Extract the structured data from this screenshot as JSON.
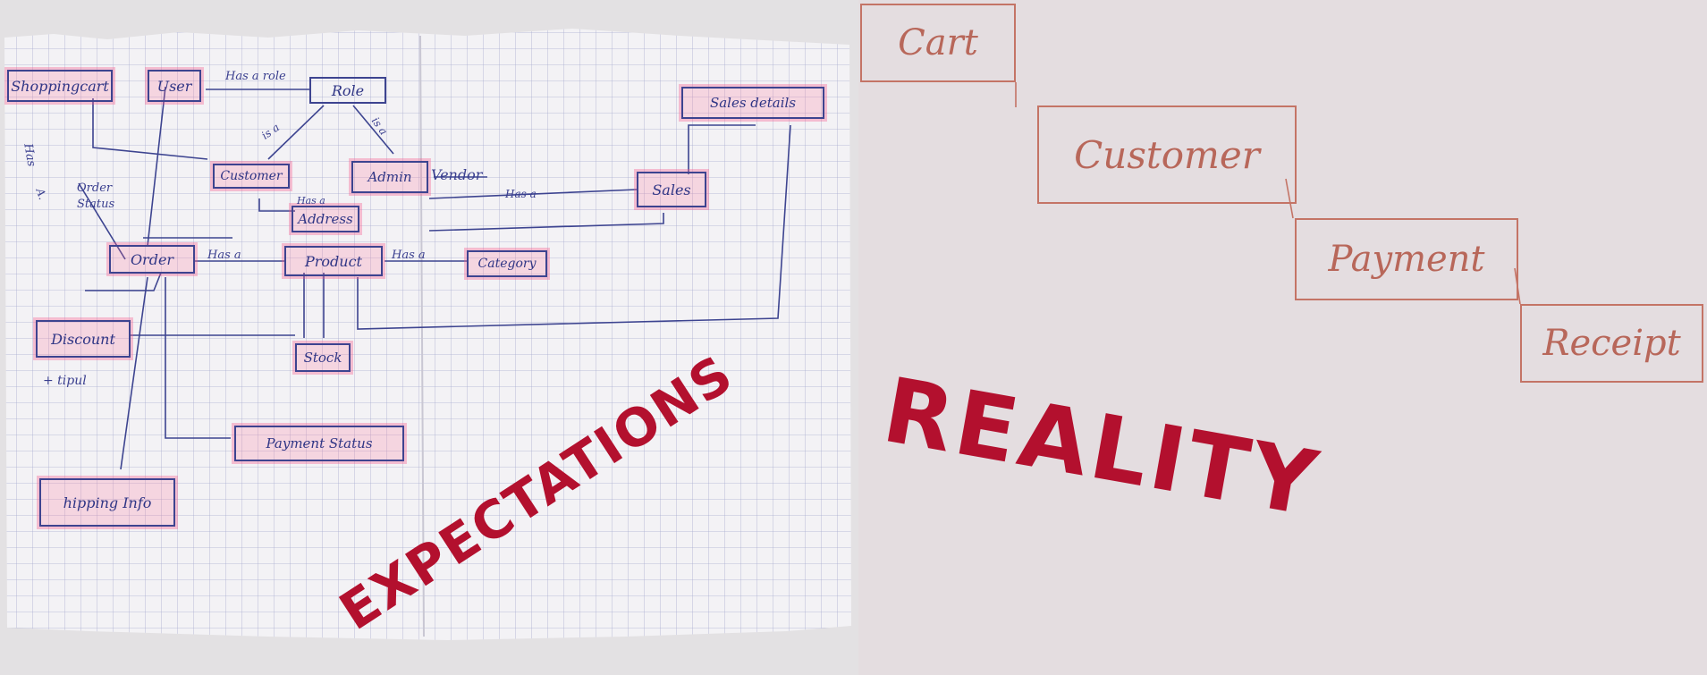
{
  "colors": {
    "ink": "#3d4490",
    "highlighter": "#f06a96",
    "red_pen": "#c47466",
    "banner": "#b3102e"
  },
  "expectations": {
    "banner": "EXPECTATIONS",
    "nodes": {
      "shopping_cart": "Shoppingcart",
      "user": "User",
      "role": "Role",
      "sales_details": "Sales details",
      "customer": "Customer",
      "admin": "Admin",
      "vendor": "Vendor",
      "sales": "Sales",
      "order_status": "Order Status",
      "address": "Address",
      "order": "Order",
      "product": "Product",
      "category": "Category",
      "discount": "Discount",
      "stock": "Stock",
      "payment_status": "Payment Status",
      "shipping_info": "hipping Info"
    },
    "edge_labels": {
      "has_a_role": "Has a role",
      "is_a_1": "is a",
      "is_a_2": "is a",
      "has_a_sales": "Has a",
      "has_a_address": "Has a",
      "has_a_product": "Has a",
      "has_a_category": "Has a",
      "has_side": "Has",
      "a_side": "A.",
      "note": "+ tipul"
    }
  },
  "reality": {
    "banner": "REALITY",
    "nodes": {
      "cart": "Cart",
      "customer": "Customer",
      "payment": "Payment",
      "receipt": "Receipt"
    }
  }
}
